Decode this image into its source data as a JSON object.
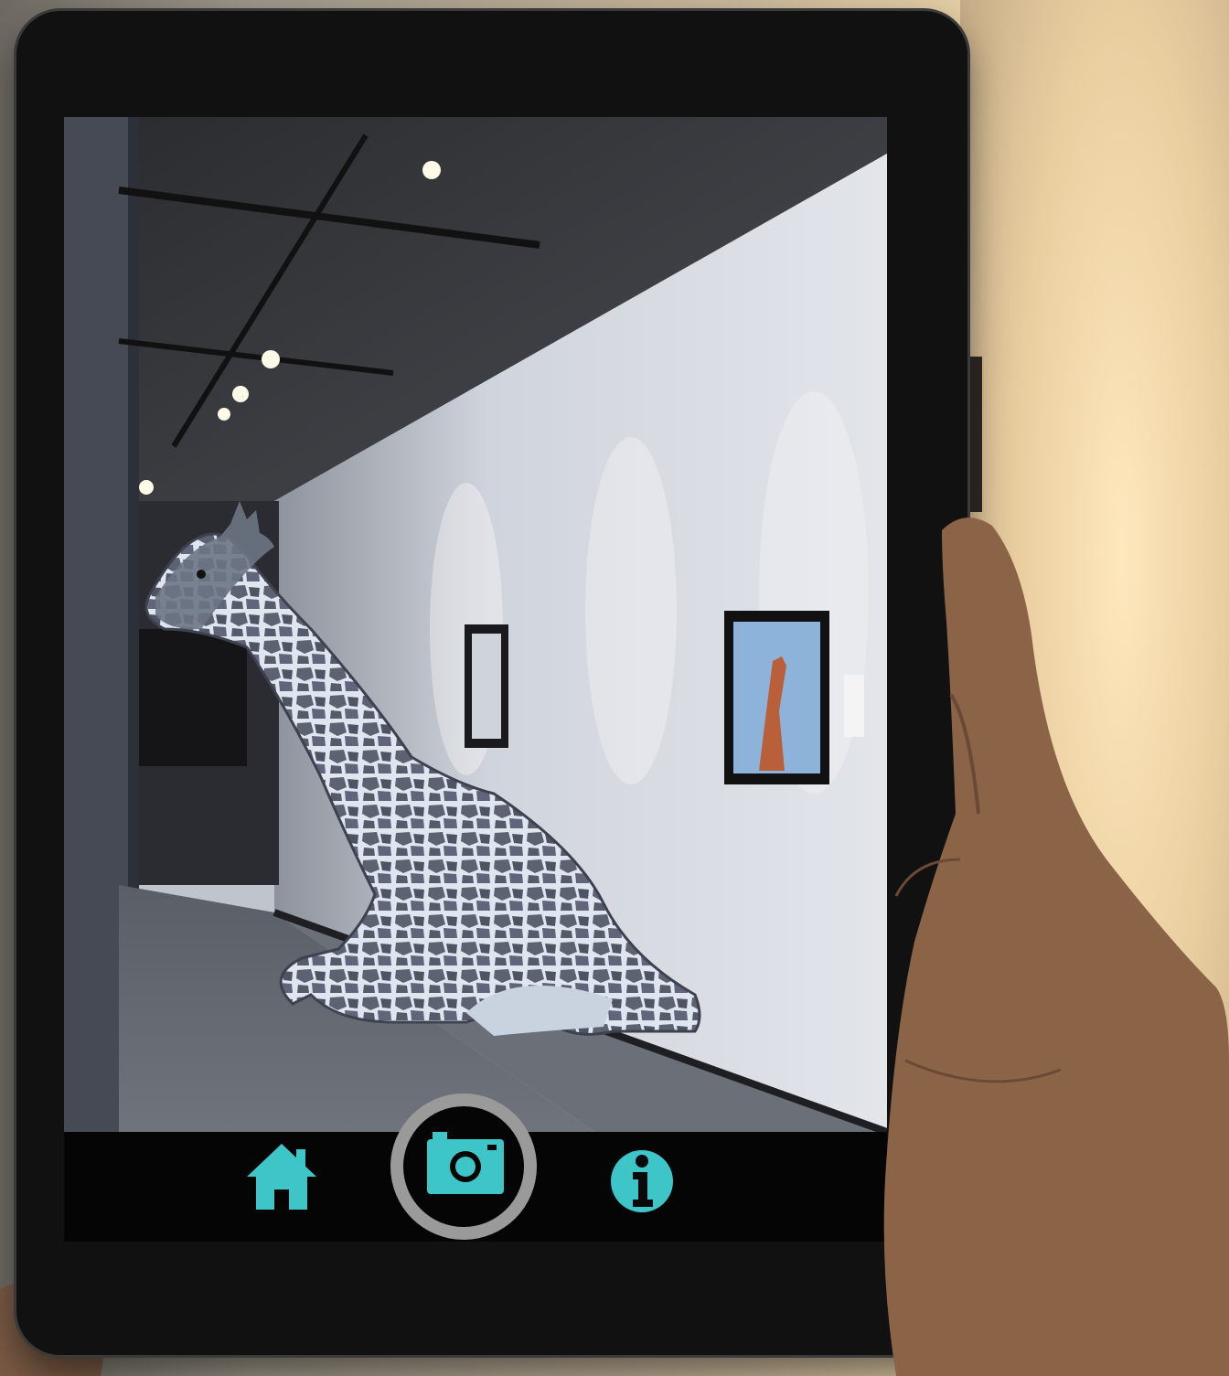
{
  "colors": {
    "accent": "#3ec5c8",
    "tablet_bezel": "#111111",
    "ui_bar": "#050505",
    "camera_ring": "#9a9a9a"
  },
  "toolbar": {
    "home_icon": "home-icon",
    "camera_icon": "camera-icon",
    "info_icon": "info-icon"
  }
}
